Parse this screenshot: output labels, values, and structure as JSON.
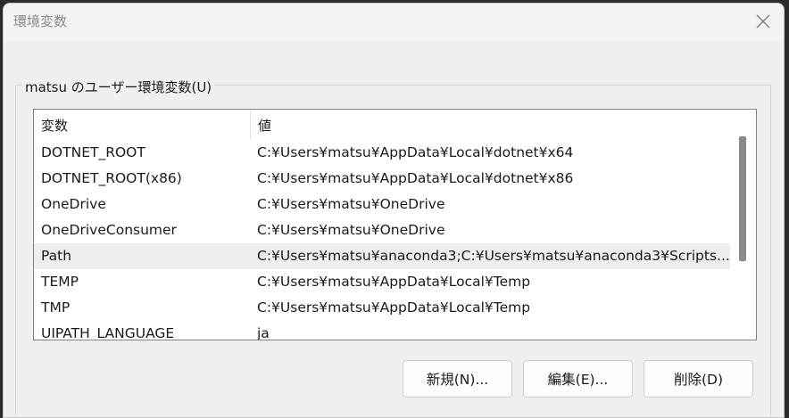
{
  "window": {
    "title": "環境変数"
  },
  "user_vars": {
    "group_label": "matsu のユーザー環境変数(U)",
    "columns": {
      "name": "変数",
      "value": "値"
    },
    "rows": [
      {
        "name": "DOTNET_ROOT",
        "value": "C:¥Users¥matsu¥AppData¥Local¥dotnet¥x64"
      },
      {
        "name": "DOTNET_ROOT(x86)",
        "value": "C:¥Users¥matsu¥AppData¥Local¥dotnet¥x86"
      },
      {
        "name": "OneDrive",
        "value": "C:¥Users¥matsu¥OneDrive"
      },
      {
        "name": "OneDriveConsumer",
        "value": "C:¥Users¥matsu¥OneDrive"
      },
      {
        "name": "Path",
        "value": "C:¥Users¥matsu¥anaconda3;C:¥Users¥matsu¥anaconda3¥Scripts..."
      },
      {
        "name": "TEMP",
        "value": "C:¥Users¥matsu¥AppData¥Local¥Temp"
      },
      {
        "name": "TMP",
        "value": "C:¥Users¥matsu¥AppData¥Local¥Temp"
      },
      {
        "name": "UIPATH_LANGUAGE",
        "value": "ja"
      }
    ],
    "selected_row": "Path",
    "buttons": {
      "new": "新規(N)...",
      "edit": "編集(E)...",
      "delete": "削除(D)"
    }
  },
  "icons": {
    "close": "close-icon"
  }
}
